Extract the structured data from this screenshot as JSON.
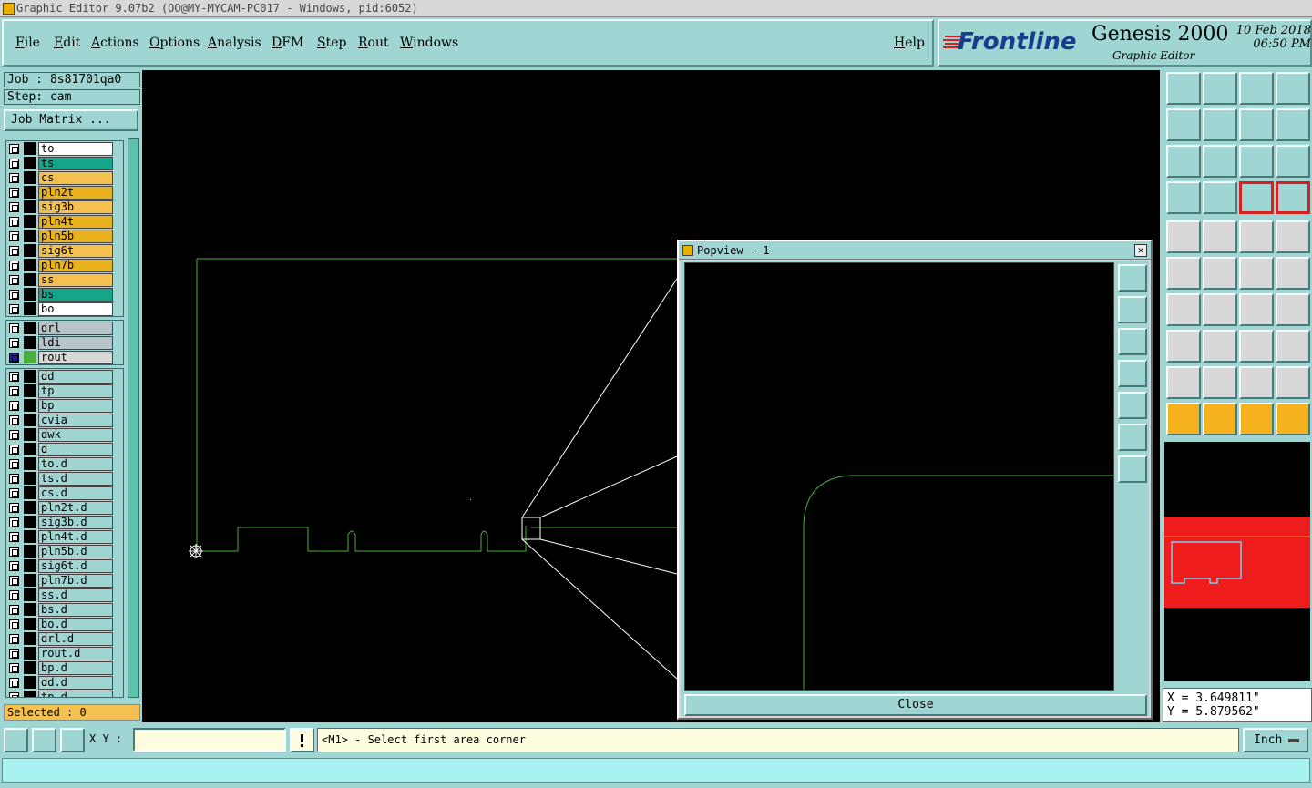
{
  "window": {
    "title": "Graphic Editor 9.07b2 (OO@MY-MYCAM-PC017 - Windows, pid:6052)"
  },
  "menu": [
    "File",
    "Edit",
    "Actions",
    "Options",
    "Analysis",
    "DFM",
    "Step",
    "Rout",
    "Windows"
  ],
  "help_label": "Help",
  "branding": {
    "logo": "Frontline",
    "product": "Genesis 2000",
    "subtitle": "Graphic Editor",
    "date": "10 Feb 2018",
    "time": "06:50 PM"
  },
  "job": {
    "job_label": "Job : 8s81701qa0",
    "step_label": "Step: cam",
    "matrix_button": "Job Matrix ..."
  },
  "layer_groups": [
    [
      {
        "name": "to",
        "color": "#ffffff"
      },
      {
        "name": "ts",
        "color": "#14a58a"
      },
      {
        "name": "cs",
        "color": "#f4c050"
      },
      {
        "name": "pln2t",
        "color": "#e8b21e"
      },
      {
        "name": "sig3b",
        "color": "#f4c050"
      },
      {
        "name": "pln4t",
        "color": "#e8b21e"
      },
      {
        "name": "pln5b",
        "color": "#e8b21e"
      },
      {
        "name": "sig6t",
        "color": "#f4c050"
      },
      {
        "name": "pln7b",
        "color": "#e8b21e"
      },
      {
        "name": "ss",
        "color": "#f4c050"
      },
      {
        "name": "bs",
        "color": "#14a58a"
      },
      {
        "name": "bo",
        "color": "#ffffff"
      }
    ],
    [
      {
        "name": "drl",
        "color": "#b8c4c8"
      },
      {
        "name": "ldi",
        "color": "#b8c4c8"
      },
      {
        "name": "rout",
        "color": "#d8d8d8",
        "active": true
      }
    ],
    [
      {
        "name": "dd",
        "color": "#9fd6d3"
      },
      {
        "name": "tp",
        "color": "#9fd6d3"
      },
      {
        "name": "bp",
        "color": "#9fd6d3"
      },
      {
        "name": "cvia",
        "color": "#9fd6d3"
      },
      {
        "name": "dwk",
        "color": "#9fd6d3"
      },
      {
        "name": "d",
        "color": "#9fd6d3"
      },
      {
        "name": "to.d",
        "color": "#9fd6d3"
      },
      {
        "name": "ts.d",
        "color": "#9fd6d3"
      },
      {
        "name": "cs.d",
        "color": "#9fd6d3"
      },
      {
        "name": "pln2t.d",
        "color": "#9fd6d3"
      },
      {
        "name": "sig3b.d",
        "color": "#9fd6d3"
      },
      {
        "name": "pln4t.d",
        "color": "#9fd6d3"
      },
      {
        "name": "pln5b.d",
        "color": "#9fd6d3"
      },
      {
        "name": "sig6t.d",
        "color": "#9fd6d3"
      },
      {
        "name": "pln7b.d",
        "color": "#9fd6d3"
      },
      {
        "name": "ss.d",
        "color": "#9fd6d3"
      },
      {
        "name": "bs.d",
        "color": "#9fd6d3"
      },
      {
        "name": "bo.d",
        "color": "#9fd6d3"
      },
      {
        "name": "drl.d",
        "color": "#9fd6d3"
      },
      {
        "name": "rout.d",
        "color": "#9fd6d3"
      },
      {
        "name": "bp.d",
        "color": "#9fd6d3"
      },
      {
        "name": "dd.d",
        "color": "#9fd6d3"
      },
      {
        "name": "tp.d",
        "color": "#9fd6d3"
      }
    ]
  ],
  "selected": "Selected : 0",
  "popview": {
    "title": "Popview - 1",
    "close_label": "Close"
  },
  "coords": {
    "x": "X = 3.649811\"",
    "y": "Y = 5.879562\""
  },
  "xy_label": "X Y :",
  "prompt": "<M1> - Select first area corner",
  "unit": "Inch",
  "colors": {
    "panel": "#9fd6d3",
    "canvas": "#000000",
    "outline": "#4caf3c",
    "minimap": "#ee1c1c"
  }
}
